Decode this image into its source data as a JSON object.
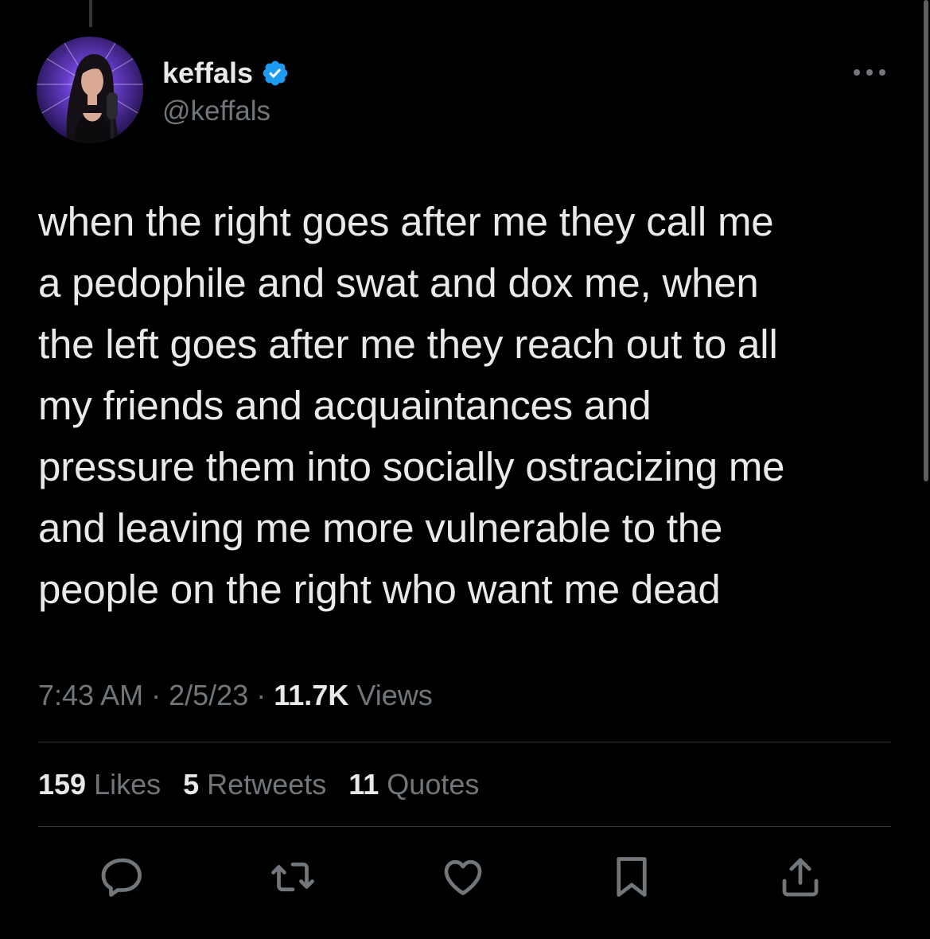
{
  "author": {
    "display_name": "keffals",
    "handle": "@keffals",
    "verified": true
  },
  "tweet": {
    "lines": [
      "when the right goes after me they call me",
      "a pedophile and swat and dox me, when",
      "the left goes after me they reach out to all",
      "my friends and acquaintances and",
      "pressure them into socially ostracizing me",
      "and leaving me more vulnerable to the",
      "people on the right who want me dead"
    ]
  },
  "meta": {
    "time": "7:43 AM",
    "separator": "·",
    "date": "2/5/23",
    "views_count": "11.7K",
    "views_label": "Views"
  },
  "stats": {
    "likes_count": "159",
    "likes_label": "Likes",
    "retweets_count": "5",
    "retweets_label": "Retweets",
    "quotes_count": "11",
    "quotes_label": "Quotes"
  },
  "icons": {
    "more": "more-horizontal-icon",
    "verified": "verified-badge-icon",
    "reply": "reply-icon",
    "retweet": "retweet-icon",
    "like": "heart-icon",
    "bookmark": "bookmark-icon",
    "share": "share-icon"
  },
  "colors": {
    "background": "#000000",
    "text_primary": "#e7e9ea",
    "text_secondary": "#71767b",
    "verified_blue": "#1d9bf0",
    "divider": "#2f3336"
  }
}
